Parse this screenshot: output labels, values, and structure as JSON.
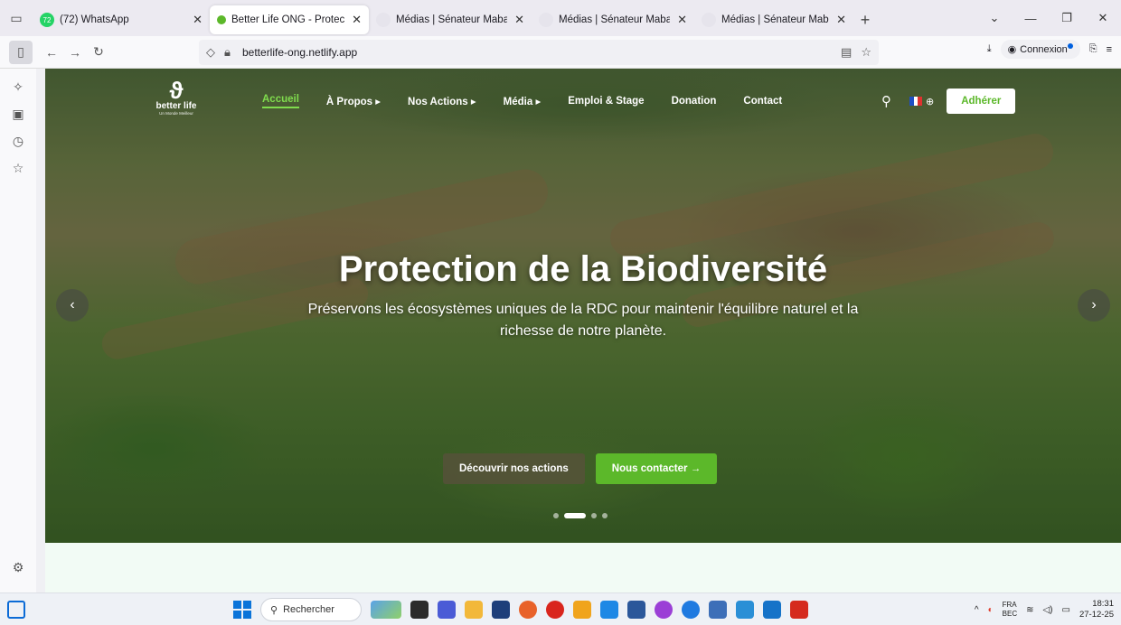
{
  "browser": {
    "tabs": [
      {
        "title": "(72) WhatsApp",
        "badge": "72",
        "favicon": "whatsapp-icon",
        "active": false
      },
      {
        "title": "Better Life ONG - Protection de",
        "favicon": "betterlife-icon",
        "active": true
      },
      {
        "title": "Médias | Sénateur Mabaya",
        "favicon": "page-icon",
        "active": false
      },
      {
        "title": "Médias | Sénateur Mabaya",
        "favicon": "page-icon",
        "active": false
      },
      {
        "title": "Médias | Sénateur Mabaya",
        "favicon": "page-icon",
        "active": false
      }
    ],
    "url": "betterlife-ong.netlify.app",
    "connexion_label": "Connexion"
  },
  "site": {
    "logo_name": "better life",
    "logo_tagline": "Un Monde Meilleur",
    "menu": [
      {
        "label": "Accueil",
        "active": true
      },
      {
        "label": "À Propos ▸",
        "active": false
      },
      {
        "label": "Nos Actions ▸",
        "active": false
      },
      {
        "label": "Média ▸",
        "active": false
      },
      {
        "label": "Emploi & Stage",
        "active": false
      },
      {
        "label": "Donation",
        "active": false
      },
      {
        "label": "Contact",
        "active": false
      }
    ],
    "adherer_label": "Adhérer",
    "hero": {
      "title": "Protection de la Biodiversité",
      "subtitle": "Préservons les écosystèmes uniques de la RDC pour maintenir l'équilibre naturel et la richesse de notre planète.",
      "cta_primary": "Découvrir nos actions",
      "cta_secondary": "Nous contacter →",
      "slide_count": 4,
      "active_slide": 2
    }
  },
  "taskbar": {
    "search_placeholder": "Rechercher",
    "lang_top": "FRA",
    "lang_bottom": "BEC",
    "time": "18:31",
    "date": "27-12-25"
  },
  "colors": {
    "brand_green": "#5cb82a",
    "menu_active": "#7fdc4d"
  }
}
